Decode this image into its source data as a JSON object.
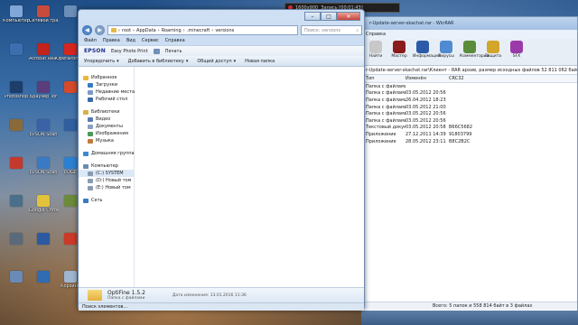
{
  "desktop": {
    "icons": [
      {
        "label": "Компьютер",
        "color": "#7fa7d8"
      },
      {
        "label": "Сетевой граф",
        "color": "#c94b3c"
      },
      {
        "label": "",
        "color": "#6c8fb8"
      },
      {
        "label": "",
        "color": "#3d6fb0"
      },
      {
        "label": "Acrobat Reader DC",
        "color": "#c2241b"
      },
      {
        "label": "OperaPortable",
        "color": "#d7261e"
      },
      {
        "label": "Photoshop",
        "color": "#1d3d6b"
      },
      {
        "label": "Браузер Tor",
        "color": "#5a3d7a"
      },
      {
        "label": "",
        "color": "#d44a2a"
      },
      {
        "label": "",
        "color": "#8a6a3a"
      },
      {
        "label": "EPSON Scan",
        "color": "#3b61a6"
      },
      {
        "label": "",
        "color": "#2f5f9e"
      },
      {
        "label": "",
        "color": "#c33a2c"
      },
      {
        "label": "EPSON Scan",
        "color": "#3a7ac2"
      },
      {
        "label": "EDGE",
        "color": "#2d7fd1"
      },
      {
        "label": "",
        "color": "#4a6f8a"
      },
      {
        "label": "Google Chrome",
        "color": "#e2c23a"
      },
      {
        "label": "",
        "color": "#6b8b3a"
      },
      {
        "label": "",
        "color": "#5a6a7a"
      },
      {
        "label": "",
        "color": "#2c5aa0"
      },
      {
        "label": "",
        "color": "#cc3a2a"
      },
      {
        "label": "",
        "color": "#6a8ab8"
      },
      {
        "label": "",
        "color": "#2f6cb3"
      },
      {
        "label": "Корзина",
        "color": "#9fb6cf"
      }
    ]
  },
  "recorder": {
    "resolution": "1600x900",
    "status": "Запись [00:01:43]"
  },
  "winrar": {
    "title": "r-Update-server-skachat.rar - WinRAR",
    "menu": [
      "Справка"
    ],
    "tools": [
      {
        "label": "Найти",
        "color": "#c8c8c8"
      },
      {
        "label": "Мастер",
        "color": "#8b1a1a"
      },
      {
        "label": "Информация",
        "color": "#2a5aa8"
      },
      {
        "label": "Вирусы",
        "color": "#4f8bd0"
      },
      {
        "label": "Комментарий",
        "color": "#5a8c3a"
      },
      {
        "label": "Защита",
        "color": "#d2a62a"
      },
      {
        "label": "SFX",
        "color": "#9a3aa8"
      }
    ],
    "path": "r-Update-server-skachat.rar\\Клиент - RAR архив, размер исходных файлов 52 811 062 байт",
    "columns": [
      "Тип",
      "Изменён",
      "CRC32"
    ],
    "rows": [
      [
        "Папка с файлами",
        "",
        ""
      ],
      [
        "Папка с файлами",
        "03.05.2012 20:56",
        ""
      ],
      [
        "Папка с файлами",
        "26.04.2012 18:23",
        ""
      ],
      [
        "Папка с файлами",
        "03.05.2012 21:00",
        ""
      ],
      [
        "Папка с файлами",
        "03.05.2012 20:56",
        ""
      ],
      [
        "Папка с файлами",
        "03.05.2012 20:56",
        ""
      ],
      [
        "Текстовый докум...",
        "03.05.2012 20:58",
        "B66C5682"
      ],
      [
        "Приложение",
        "27.12.2011 14:39",
        "91803799"
      ],
      [
        "Приложение",
        "28.05.2012 23:11",
        "B8C2B2C"
      ]
    ],
    "status": "Всего: 5 папок и 558 814 байт в 3 файлах"
  },
  "explorer": {
    "address": [
      "root",
      "AppData",
      "Roaming",
      ".minecraft",
      "versions"
    ],
    "search_placeholder": "Поиск: versions",
    "menu": [
      "Файл",
      "Правка",
      "Вид",
      "Сервис",
      "Справка"
    ],
    "epson": {
      "logo": "EPSON",
      "app": "Easy Photo Print",
      "print": "Печать"
    },
    "toolbar": [
      "Упорядочить",
      "Добавить в библиотеку",
      "Общий доступ",
      "Новая папка"
    ],
    "nav": [
      {
        "head": "Избранное",
        "color": "#e8b83a",
        "items": [
          {
            "label": "Загрузки",
            "color": "#3a7ac2"
          },
          {
            "label": "Недавние места",
            "color": "#7a9ac2"
          },
          {
            "label": "Рабочий стол",
            "color": "#3a6aa8"
          }
        ]
      },
      {
        "head": "Библиотеки",
        "color": "#d8b04a",
        "items": [
          {
            "label": "Видео",
            "color": "#5a7ab0"
          },
          {
            "label": "Документы",
            "color": "#8aa0c0"
          },
          {
            "label": "Изображения",
            "color": "#4a9a5a"
          },
          {
            "label": "Музыка",
            "color": "#c27a3a"
          }
        ]
      },
      {
        "head": "Домашняя группа",
        "color": "#3a8ad0",
        "items": []
      },
      {
        "head": "Компьютер",
        "color": "#6a8ab0",
        "items": [
          {
            "label": "(C:) SYSTEM",
            "color": "#8a9ab0"
          },
          {
            "label": "(D:) Новый том",
            "color": "#8a9ab0"
          },
          {
            "label": "(E:) Новый том",
            "color": "#8a9ab0"
          }
        ]
      },
      {
        "head": "Сеть",
        "color": "#3a7ac2",
        "items": []
      }
    ],
    "details": {
      "name": "OptiFine 1.5.2",
      "type": "Папка с файлами",
      "date": "Дата изменения: 13.01.2016 11:36"
    },
    "status": "Поиск элементов..."
  }
}
